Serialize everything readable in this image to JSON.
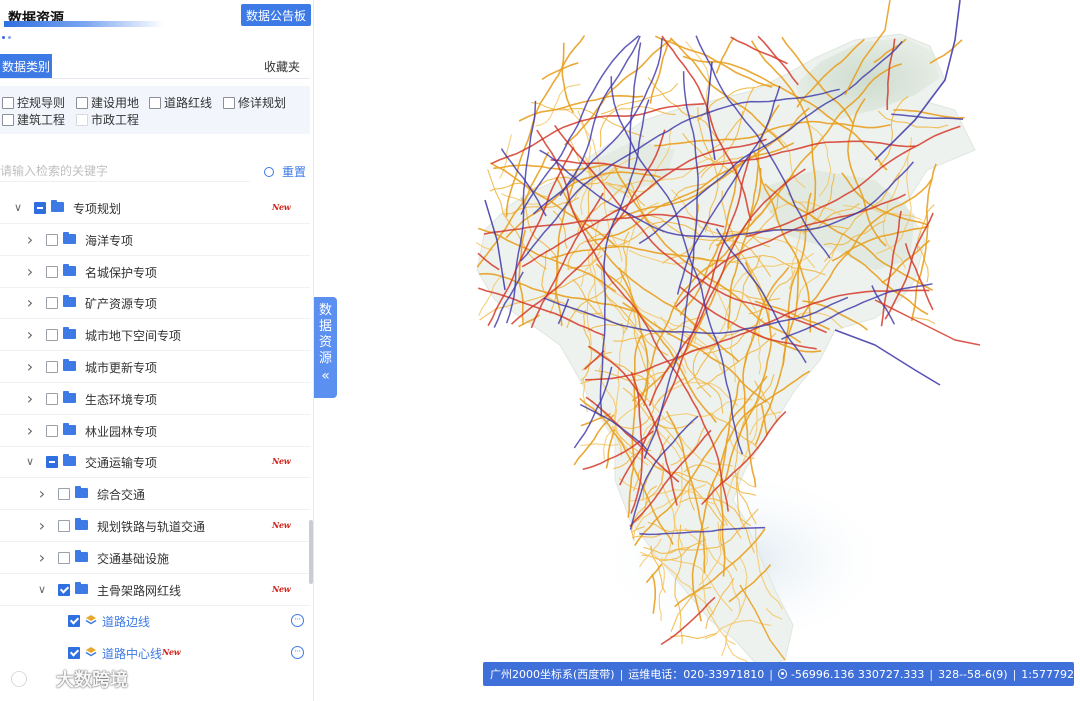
{
  "panel": {
    "title": "数据资源",
    "board_button": "数据公告板",
    "tabs": {
      "active": "数据类别",
      "favorites": "收藏夹"
    },
    "filters": [
      "控规导则",
      "建设用地",
      "道路红线",
      "修详规划",
      "建筑工程",
      "市政工程"
    ],
    "search": {
      "placeholder": "请输入检索的关键字",
      "reset": "重置"
    },
    "tree": [
      {
        "label": "专项规划",
        "level": 0,
        "expanded": true,
        "check": "partial",
        "new": true
      },
      {
        "label": "海洋专项",
        "level": 1,
        "expanded": false,
        "check": "none",
        "new": false
      },
      {
        "label": "名城保护专项",
        "level": 1,
        "expanded": false,
        "check": "none",
        "new": false
      },
      {
        "label": "矿产资源专项",
        "level": 1,
        "expanded": false,
        "check": "none",
        "new": false
      },
      {
        "label": "城市地下空间专项",
        "level": 1,
        "expanded": false,
        "check": "none",
        "new": false
      },
      {
        "label": "城市更新专项",
        "level": 1,
        "expanded": false,
        "check": "none",
        "new": false
      },
      {
        "label": "生态环境专项",
        "level": 1,
        "expanded": false,
        "check": "none",
        "new": false
      },
      {
        "label": "林业园林专项",
        "level": 1,
        "expanded": false,
        "check": "none",
        "new": false
      },
      {
        "label": "交通运输专项",
        "level": 1,
        "expanded": true,
        "check": "partial",
        "new": true
      },
      {
        "label": "综合交通",
        "level": 2,
        "expanded": false,
        "check": "none",
        "new": false
      },
      {
        "label": "规划铁路与轨道交通",
        "level": 2,
        "expanded": false,
        "check": "none",
        "new": true
      },
      {
        "label": "交通基础设施",
        "level": 2,
        "expanded": false,
        "check": "none",
        "new": false
      },
      {
        "label": "主骨架路网红线",
        "level": 2,
        "expanded": true,
        "check": "checked",
        "new": true
      },
      {
        "label": "道路边线",
        "level": 3,
        "leaf": true,
        "check": "checked",
        "new": false
      },
      {
        "label": "道路中心线",
        "level": 3,
        "leaf": true,
        "check": "checked",
        "new": true
      }
    ],
    "new_badge": "New",
    "more_glyph": "···"
  },
  "collapse_tab": {
    "label": "数据资源",
    "chevron": "«"
  },
  "statusbar": {
    "crs": "广州2000坐标系(西度带)",
    "phone": "运维电话：020-33971810",
    "coords": "-56996.136 330727.333",
    "tile": "328--58-6(9)",
    "scale": "1:577792"
  },
  "watermark": "大数跨境",
  "colors": {
    "accent": "#3d7ae6",
    "road_major": "#e8a020",
    "road_red": "#d43a2a",
    "road_blue": "#3a33a8",
    "new_badge": "#d0221a"
  }
}
